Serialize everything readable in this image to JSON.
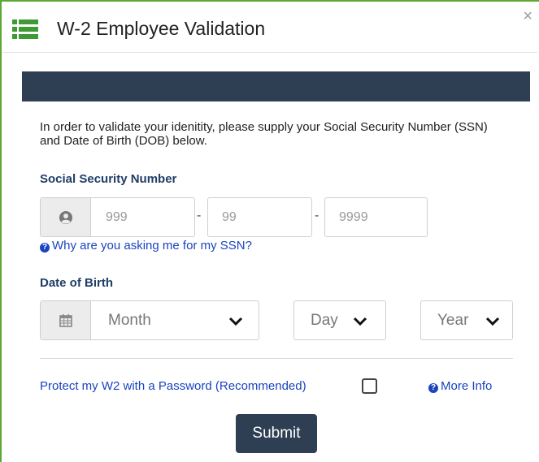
{
  "dialog": {
    "title": "W-2 Employee Validation",
    "close_glyph": "×",
    "icon": "list-icon"
  },
  "intro_text": "In order to validate your idenitity, please supply your Social Security Number (SSN) and Date of Birth (DOB) below.",
  "ssn": {
    "label": "Social Security Number",
    "part1_placeholder": "999",
    "part2_placeholder": "99",
    "part3_placeholder": "9999",
    "separator": "-",
    "icon": "user-icon",
    "help_link": "Why are you asking me for my SSN?"
  },
  "dob": {
    "label": "Date of Birth",
    "icon": "calendar-icon",
    "month": "Month",
    "day": "Day",
    "year": "Year"
  },
  "password": {
    "label": "Protect my W2 with a Password (Recommended)",
    "more_info": "More Info"
  },
  "submit_label": "Submit",
  "colors": {
    "accent_green": "#3e9a34",
    "navy": "#2e3f53",
    "label_blue": "#203d66",
    "link_blue": "#1a43c0"
  }
}
